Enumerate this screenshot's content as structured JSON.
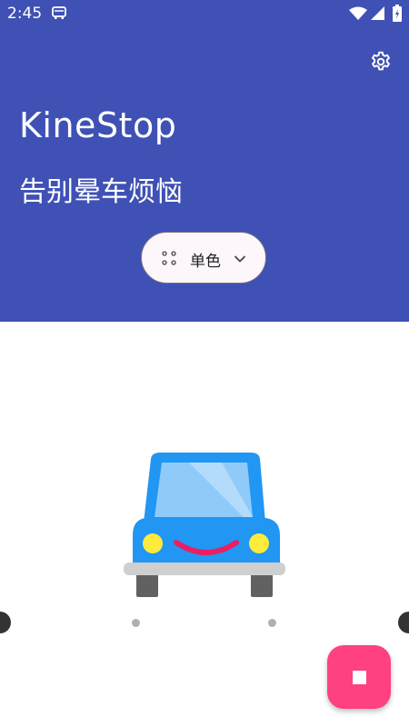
{
  "status_bar": {
    "time": "2:45"
  },
  "header": {
    "title": "KineStop",
    "subtitle": "告别晕车烦恼",
    "background_color": "#3f51b5",
    "settings_icon": "gear-icon"
  },
  "mode_selector": {
    "label": "单色",
    "icon": "dots-grid-icon",
    "dropdown_icon": "chevron-down-icon"
  },
  "fab": {
    "icon": "stop-icon",
    "color": "#ff4081"
  },
  "colors": {
    "car_body": "#2196f3",
    "car_window": "#90caf9",
    "car_headlight": "#ffeb3b",
    "car_smile": "#e91e63"
  }
}
